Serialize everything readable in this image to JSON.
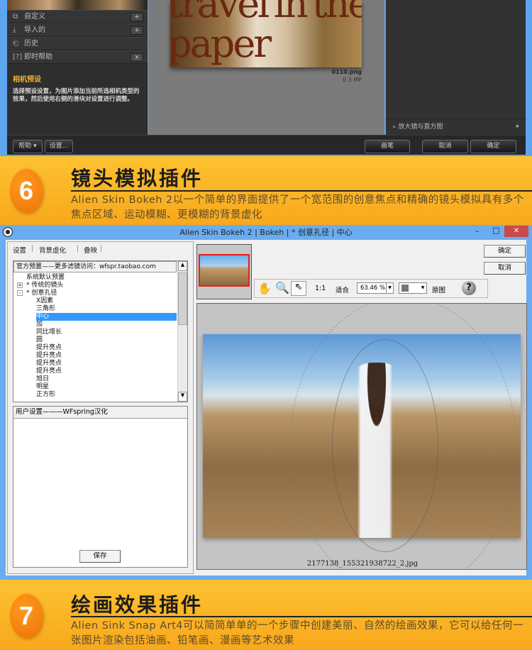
{
  "top_app": {
    "left_rows": [
      {
        "icon": "custom-icon",
        "label": "自定义",
        "action": "+"
      },
      {
        "icon": "import-icon",
        "label": "导入的",
        "action": "+"
      },
      {
        "icon": "history-icon",
        "label": "历史",
        "action": ""
      },
      {
        "icon": "[?]",
        "label": "即时帮助",
        "action": "x"
      }
    ],
    "help_title": "相机预设",
    "help_text": "选择预设设置，为图片添加当前所选相机类型的效果，然后使用右侧的滑块对设置进行调整。",
    "poster_text": "Travel in the paper",
    "file_name": "0110.png",
    "file_size": "0.3 MP",
    "right_section": "放大镜与直方图",
    "buttons": {
      "help": "帮助 ▾",
      "settings": "设置...",
      "brush": "画笔",
      "cancel": "取消",
      "ok": "确定"
    }
  },
  "section6": {
    "number": "6",
    "title": "镜头模拟插件",
    "text": "Alien Skin Bokeh 2以一个简单的界面提供了一个宽范围的创意焦点和精确的镜头模拟具有多个焦点区域、运动模糊、更模糊的背景虚化"
  },
  "window": {
    "title": "Alien Skin Bokeh 2 | Bokeh | * 创意孔径 | 中心",
    "tabs": [
      "设置",
      "背景虚化",
      "叠映"
    ],
    "tree_header": "官方预置——更多滤镜访问：wfspr.taobao.com",
    "tree_items": [
      {
        "label": "系统默认预置",
        "level": 0,
        "exp": ""
      },
      {
        "label": "* 传统的镜头",
        "level": 0,
        "exp": "+"
      },
      {
        "label": "* 创意孔径",
        "level": 0,
        "exp": "-"
      },
      {
        "label": "X因素",
        "level": 1
      },
      {
        "label": "三角形",
        "level": 1
      },
      {
        "label": "中心",
        "level": 1,
        "selected": true
      },
      {
        "label": "加",
        "level": 1
      },
      {
        "label": "同比增长",
        "level": 1
      },
      {
        "label": "圆",
        "level": 1
      },
      {
        "label": "提升亮点",
        "level": 1
      },
      {
        "label": "提升亮点",
        "level": 1
      },
      {
        "label": "提升亮点",
        "level": 1
      },
      {
        "label": "提升亮点",
        "level": 1
      },
      {
        "label": "旭日",
        "level": 1
      },
      {
        "label": "明星",
        "level": 1
      },
      {
        "label": "正方形",
        "level": 1
      }
    ],
    "user_header": "用户设置———WFspring汉化",
    "save": "保存",
    "ok": "确定",
    "cancel": "取消",
    "toolbar": {
      "ratio": "1:1",
      "fit": "适合",
      "zoom": "63.46 %",
      "original": "原图",
      "help": "?"
    },
    "preview_file": "2177138_155321938722_2.jpg",
    "controls": {
      "minimize": "–",
      "maximize": "□",
      "close": "✕"
    }
  },
  "section7": {
    "number": "7",
    "title": "绘画效果插件",
    "text": "Alien Sink Snap Art4可以简简单单的一个步骤中创建美丽、自然的绘画效果，它可以给任何一张图片渲染包括油画、铅笔画、漫画等艺术效果"
  },
  "colors": {
    "banner": "#fdbc2c",
    "circle": "#f5820f",
    "window_blue": "#6aacef",
    "selection": "#3399ff"
  }
}
